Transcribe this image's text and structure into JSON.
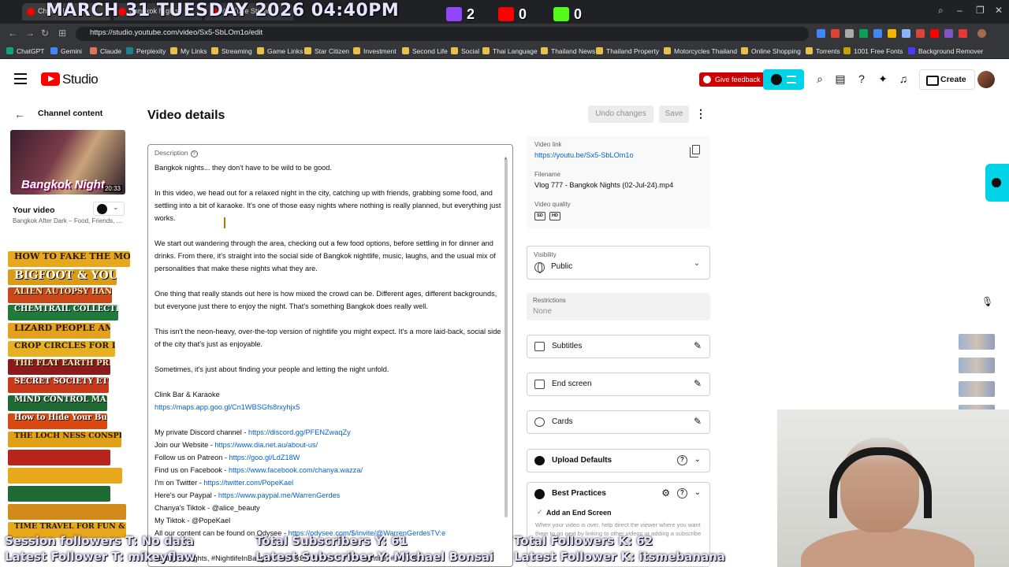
{
  "overlay": {
    "date": "MARCH 31 TUESDAY 2026 04:40PM",
    "twitch_count": "2",
    "youtube_count": "0",
    "kick_count": "0",
    "session_followers": "Session followers T: No data",
    "latest_follower_t": "Latest Follower T: mikeyflaw",
    "total_subscribers": "Total Subscribers Y: 61",
    "latest_subscriber": "Latest Subscriber Y: Michael Bonsai",
    "total_followers_k": "Total Followers K: 62",
    "latest_follower_k": "Latest Follower K: itsmebanana"
  },
  "browser": {
    "url": "https://studio.youtube.com/video/Sx5-SbLOm1o/edit",
    "tabs": [
      "Channel",
      "Bangkok Nights",
      "YouTube Studio"
    ],
    "bookmarks": [
      "ChatGPT",
      "Gemini",
      "Claude",
      "Perplexity",
      "My Links",
      "Streaming",
      "Game Links",
      "Star Citizen",
      "Investment",
      "Second Life",
      "Social",
      "Thai Language",
      "Thailand News",
      "Thailand Property",
      "Motorcycles Thailand",
      "Online Shopping",
      "Torrents",
      "1001 Free Fonts",
      "Background Remover"
    ]
  },
  "header": {
    "logo_text": "Studio",
    "feedback_label": "Give feedback",
    "create_label": "Create"
  },
  "sidebar": {
    "back_label": "Channel content",
    "thumb_title": "Bangkok Night",
    "thumb_duration": "20:33",
    "your_video_label": "Your video",
    "video_subtitle": "Bangkok After Dark – Food, Friends, ...",
    "books": [
      "HOW TO FAKE THE MOON LANDING",
      "BIGFOOT & YOU",
      "ALIEN AUTOPSY HANDBOOK",
      "CHEMTRAIL COLLECTION GUIDE",
      "LIZARD PEOPLE AMONG US",
      "CROP CIRCLES FOR DUMMIES",
      "THE FLAT EARTH PRIMER",
      "SECRET SOCIETY ETIQUETTE",
      "MIND CONTROL MADE EASY",
      "How to Hide Your Bunker",
      "THE LOCH NESS CONSPIRACY",
      "",
      "",
      "",
      "",
      "TIME TRAVEL FOR FUN & PROFIT"
    ]
  },
  "main": {
    "title": "Video details",
    "undo_label": "Undo changes",
    "save_label": "Save",
    "description_label": "Description",
    "description": {
      "p1": "Bangkok nights... they don't have to be wild to be good.",
      "p2": "In this video, we head out for a relaxed night in the city, catching up with friends, grabbing some food, and settling into a bit of karaoke. It's one of those easy nights where nothing is really planned, but everything just works.",
      "p3": "We start out wandering through the area, checking out a few food options, before settling in for dinner and drinks. From there, it's straight into the social side of Bangkok nightlife, music, laughs, and the usual mix of personalities that make these nights what they are.",
      "p4": "One thing that really stands out here is how mixed the crowd can be. Different ages, different backgrounds, but everyone just there to enjoy the night. That's something Bangkok does really well.",
      "p5": "This isn't the neon-heavy, over-the-top version of nightlife you might expect. It's a more laid-back, social side of the city that's just as enjoyable.",
      "p6": "Sometimes, it's just about finding your people and letting the night unfold.",
      "place_name": "Clink Bar & Karaoke",
      "place_url": "https://maps.app.goo.gl/Cn1WBSGfs8rxyhjx5",
      "links": [
        {
          "label": "My private Discord channel - ",
          "url": "https://discord.gg/PFENZwaqZy"
        },
        {
          "label": "Join our Website - ",
          "url": "https://www.dia.net.au/about-us/"
        },
        {
          "label": "Follow us on Patreon - ",
          "url": "https://goo.gl/LdZ18W"
        },
        {
          "label": "Find us on Facebook - ",
          "url": "https://www.facebook.com/chanya.wazza/"
        },
        {
          "label": "I'm on Twitter - ",
          "url": "https://twitter.com/PopeKael"
        },
        {
          "label": "Here's our Paypal - ",
          "url": "https://www.paypal.me/WarrenGerdes"
        },
        {
          "label": "Chanya's Tiktok - @alice_beauty",
          "url": ""
        },
        {
          "label": "My Tiktok - @PopeKael",
          "url": ""
        },
        {
          "label": "All our content can be found on Odysee - ",
          "url": "https://odysee.com/$/invite/@WarrenGerdesTV:e"
        }
      ],
      "hashtags": "#BangkokNights, #NightlifeInBangkok, #ClinkBarKaraoke, #ThaiNightlife, #Karaoke,"
    }
  },
  "right": {
    "video_link_label": "Video link",
    "video_link": "https://youtu.be/Sx5-SbLOm1o",
    "filename_label": "Filename",
    "filename": "Vlog 777 - Bangkok Nights (02-Jul-24).mp4",
    "quality_label": "Video quality",
    "quality_badges": [
      "SD",
      "HD"
    ],
    "visibility_label": "Visibility",
    "visibility_value": "Public",
    "restrictions_label": "Restrictions",
    "restrictions_value": "None",
    "subtitles_label": "Subtitles",
    "end_screen_label": "End screen",
    "cards_label": "Cards",
    "upload_defaults_label": "Upload Defaults",
    "best_practices_label": "Best Practices",
    "add_end_screen_label": "Add an End Screen",
    "add_end_screen_text": "When your video is over, help direct the viewer where you want them to go next by linking to other videos or adding a subscribe",
    "colors": {
      "accent": "#00d2e8",
      "link": "#065fd4",
      "brand": "#ff0000"
    }
  }
}
